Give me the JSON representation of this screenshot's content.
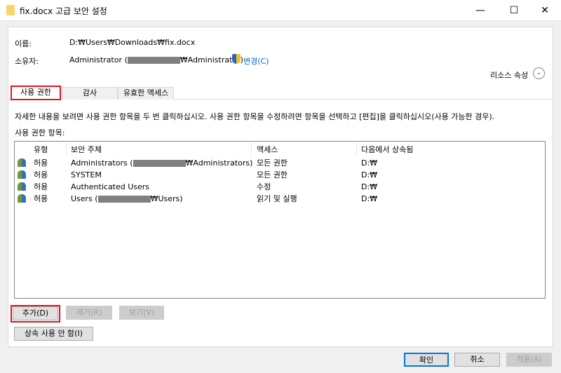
{
  "window": {
    "title": "fix.docx 고급 보안 설정",
    "minimize": "—",
    "maximize": "☐",
    "close": "✕"
  },
  "info": {
    "name_label": "이름:",
    "name_value": "D:₩Users₩Downloads₩fix.docx",
    "owner_label": "소유자:",
    "owner_prefix": "Administrator (",
    "owner_suffix": "₩Administrator)",
    "change_link": "변경(C)",
    "resource_props": "리소스 속성"
  },
  "tabs": [
    {
      "label": "사용 권한",
      "active": true
    },
    {
      "label": "감사"
    },
    {
      "label": "유효한 액세스"
    }
  ],
  "instructions": "자세한 내용을 보려면 사용 권한 항목을 두 번 클릭하십시오. 사용 권한 항목을 수정하려면 항목을 선택하고 [편집]을 클릭하십시오(사용 가능한 경우).",
  "entries_label": "사용 권한 항목:",
  "columns": [
    "유형",
    "보안 주체",
    "액세스",
    "다음에서 상속됨"
  ],
  "rows": [
    {
      "type": "허용",
      "principal_prefix": "Administrators (",
      "principal_suffix": "₩Administrators)",
      "access": "모든 권한",
      "inherited": "D:₩"
    },
    {
      "type": "허용",
      "principal_prefix": "SYSTEM",
      "principal_suffix": "",
      "access": "모든 권한",
      "inherited": "D:₩"
    },
    {
      "type": "허용",
      "principal_prefix": "Authenticated Users",
      "principal_suffix": "",
      "access": "수정",
      "inherited": "D:₩"
    },
    {
      "type": "허용",
      "principal_prefix": "Users (",
      "principal_suffix": "₩Users)",
      "access": "읽기 및 실행",
      "inherited": "D:₩"
    }
  ],
  "buttons": {
    "add": "추가(D)",
    "remove": "제거(R)",
    "view": "보기(V)",
    "disable_inherit": "상속 사용 안 함(I)",
    "ok": "확인",
    "cancel": "취소",
    "apply": "적용(A)"
  }
}
